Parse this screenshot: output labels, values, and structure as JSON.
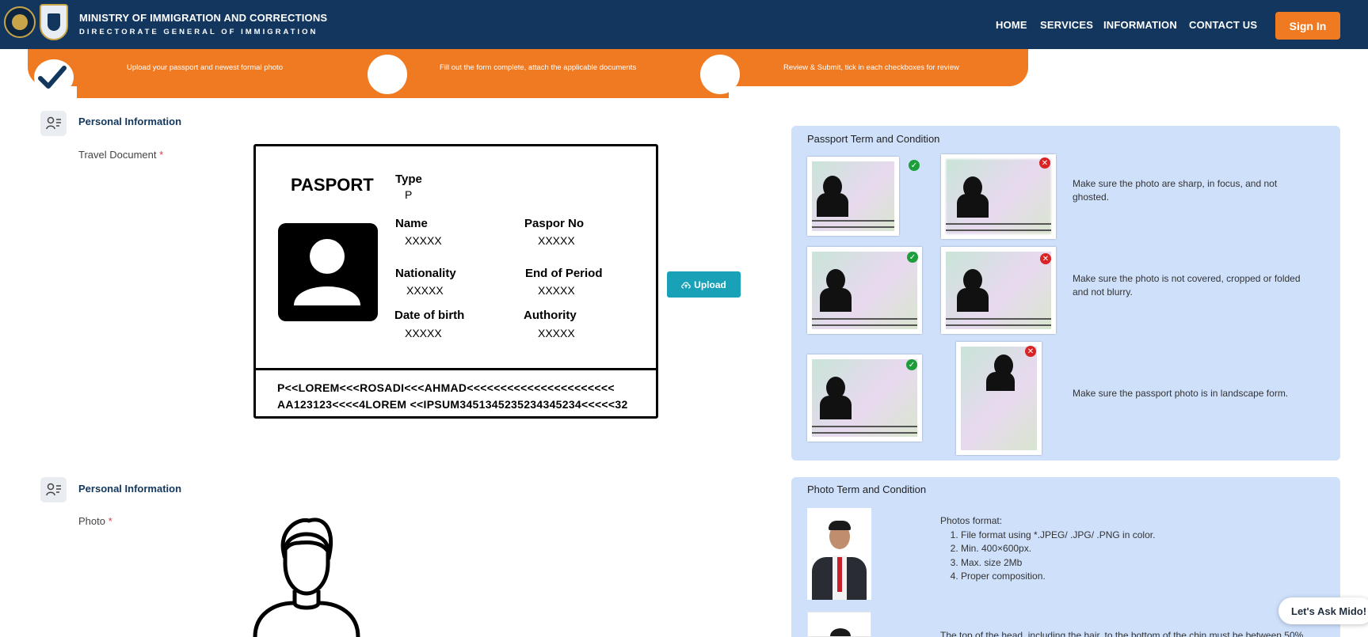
{
  "header": {
    "org_title": "MINISTRY OF IMMIGRATION AND CORRECTIONS",
    "org_subtitle": "DIRECTORATE GENERAL OF IMMIGRATION",
    "nav": [
      "HOME",
      "SERVICES",
      "INFORMATION",
      "CONTACT US"
    ],
    "sign_in": "Sign In"
  },
  "steps": [
    {
      "label": "Upload your passport and newest formal photo",
      "done": true
    },
    {
      "label": "Fill out the form complete, attach the applicable documents",
      "done": false
    },
    {
      "label": "Review & Submit, tick in each checkboxes for review",
      "done": false
    }
  ],
  "travel_section": {
    "title": "Personal Information",
    "field_label": "Travel Document",
    "required_mark": "*"
  },
  "passport": {
    "title": "PASPORT",
    "type_label": "Type",
    "type_value": "P",
    "name_label": "Name",
    "name_value": "XXXXX",
    "paspor_no_label": "Paspor No",
    "paspor_no_value": "XXXXX",
    "nationality_label": "Nationality",
    "nationality_value": "XXXXX",
    "end_label": "End of Period",
    "end_value": "XXXXX",
    "dob_label": "Date of birth",
    "dob_value": "XXXXX",
    "authority_label": "Authority",
    "authority_value": "XXXXX",
    "mrz1": "P<<LOREM<<<ROSADI<<<AHMAD<<<<<<<<<<<<<<<<<<<<<<",
    "mrz2": "AA123123<<<<4LOREM <<IPSUM3451345235234345234<<<<<32"
  },
  "upload_button": "Upload",
  "passport_terms": {
    "title": "Passport Term and Condition",
    "rules": [
      "Make sure the photo are sharp, in focus, and not ghosted.",
      "Make sure the photo is not covered, cropped or folded and not blurry.",
      "Make sure the passport photo is in landscape form."
    ]
  },
  "photo_section": {
    "title": "Personal Information",
    "field_label": "Photo",
    "required_mark": "*"
  },
  "photo_terms": {
    "title": "Photo Term and Condition",
    "format_heading": "Photos format:",
    "format_items": [
      "File format using *.JPEG/ .JPG/ .PNG in color.",
      "Min. 400×600px.",
      "Max. size 2Mb",
      "Proper composition."
    ],
    "note_partial": "The top of the head, including the hair, to the bottom of the chin must be between 50%"
  },
  "chat_widget": "Let's Ask Mido!",
  "colors": {
    "navy": "#12365e",
    "orange": "#f07a22",
    "teal": "#19a1b8",
    "panel": "#cfe0fb"
  }
}
